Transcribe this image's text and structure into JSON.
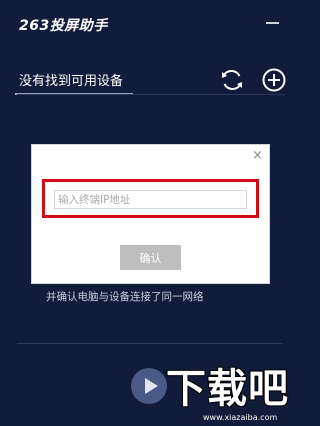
{
  "app": {
    "title": "263投屏助手"
  },
  "device": {
    "label": "没有找到可用设备"
  },
  "icons": {
    "minimize": "minimize-icon",
    "refresh": "refresh-icon",
    "add": "plus-circle-icon",
    "close": "close-icon",
    "play": "play-icon"
  },
  "dialog": {
    "close": "×",
    "ip_placeholder": "输入终端IP地址",
    "ip_value": "",
    "confirm_label": "确认"
  },
  "hint": "并确认电脑与设备连接了同一网络",
  "watermark": {
    "text": "下载吧",
    "url": "www.xiazaiba.com"
  },
  "colors": {
    "background": "#111c3b",
    "highlight": "#d40a18",
    "confirm_button": "#bdbdbd"
  }
}
